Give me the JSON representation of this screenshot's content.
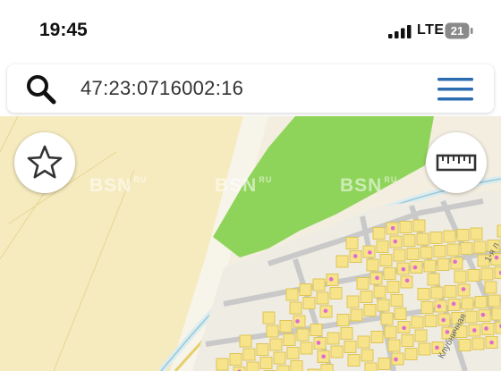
{
  "status_bar": {
    "time": "19:45",
    "network": "LTE",
    "battery": "21"
  },
  "search": {
    "value": "47:23:0716002:16"
  },
  "map": {
    "watermark": "BSN",
    "watermark_suffix": "RU",
    "street_labels": [
      "1-я л",
      "Клубничная"
    ]
  },
  "icons": {
    "search": "search-icon",
    "menu": "hamburger-menu-icon",
    "favorite": "star-icon",
    "measure": "ruler-icon"
  },
  "colors": {
    "accent": "#2c6cb0",
    "plot_fill": "#f7e38a",
    "plot_border": "#e0c95a",
    "forest": "#8fd45a",
    "road": "#c9c9c9",
    "pink_marker": "#e06bd0"
  }
}
